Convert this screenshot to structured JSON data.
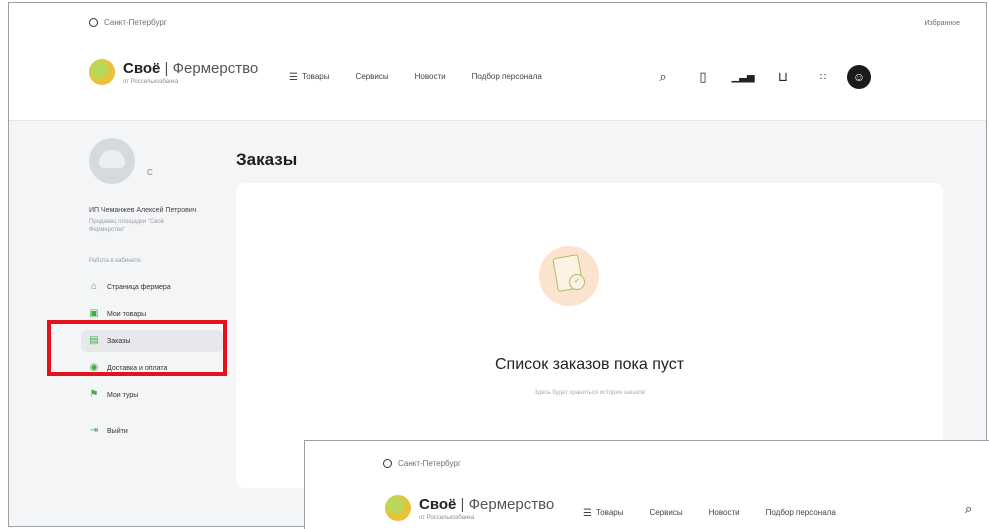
{
  "header": {
    "city": "Санкт-Петербург",
    "favorites": "Избранное",
    "brand_name": "Своё",
    "brand_suffix": "Фермерство",
    "brand_sub": "от Россельхозбанка",
    "nav": [
      "Товары",
      "Сервисы",
      "Новости",
      "Подбор персонала"
    ],
    "icons": [
      "search-icon",
      "bookmark-icon",
      "chart-icon",
      "basket-icon",
      "grid-icon",
      "user-icon"
    ]
  },
  "sidebar": {
    "user_name": "ИП Чеманжев Алексей Петрович",
    "user_role": "Продавец площадки \"Своё Фермерство\"",
    "edit_label": "С",
    "section_title": "Работа в кабинете",
    "items": [
      {
        "label": "Страница фермера",
        "icon": "home-icon"
      },
      {
        "label": "Мои товары",
        "icon": "box-icon"
      },
      {
        "label": "Заказы",
        "icon": "orders-icon",
        "active": true
      },
      {
        "label": "Доставка и оплата",
        "icon": "delivery-icon"
      },
      {
        "label": "Мои туры",
        "icon": "tour-icon"
      }
    ],
    "logout": "Выйти"
  },
  "main": {
    "title": "Заказы",
    "empty_title": "Список заказов пока пуст",
    "empty_sub": "Здесь будет храниться история заказов"
  },
  "overlay": {
    "city": "Санкт-Петербург",
    "brand_name": "Своё",
    "brand_suffix": "Фермерство",
    "brand_sub": "от Россельхозбанка",
    "nav": [
      "Товары",
      "Сервисы",
      "Новости",
      "Подбор персонала"
    ]
  },
  "colors": {
    "accent": "#3fae3f",
    "highlight": "#e0141a",
    "background": "#f4f5f7"
  }
}
